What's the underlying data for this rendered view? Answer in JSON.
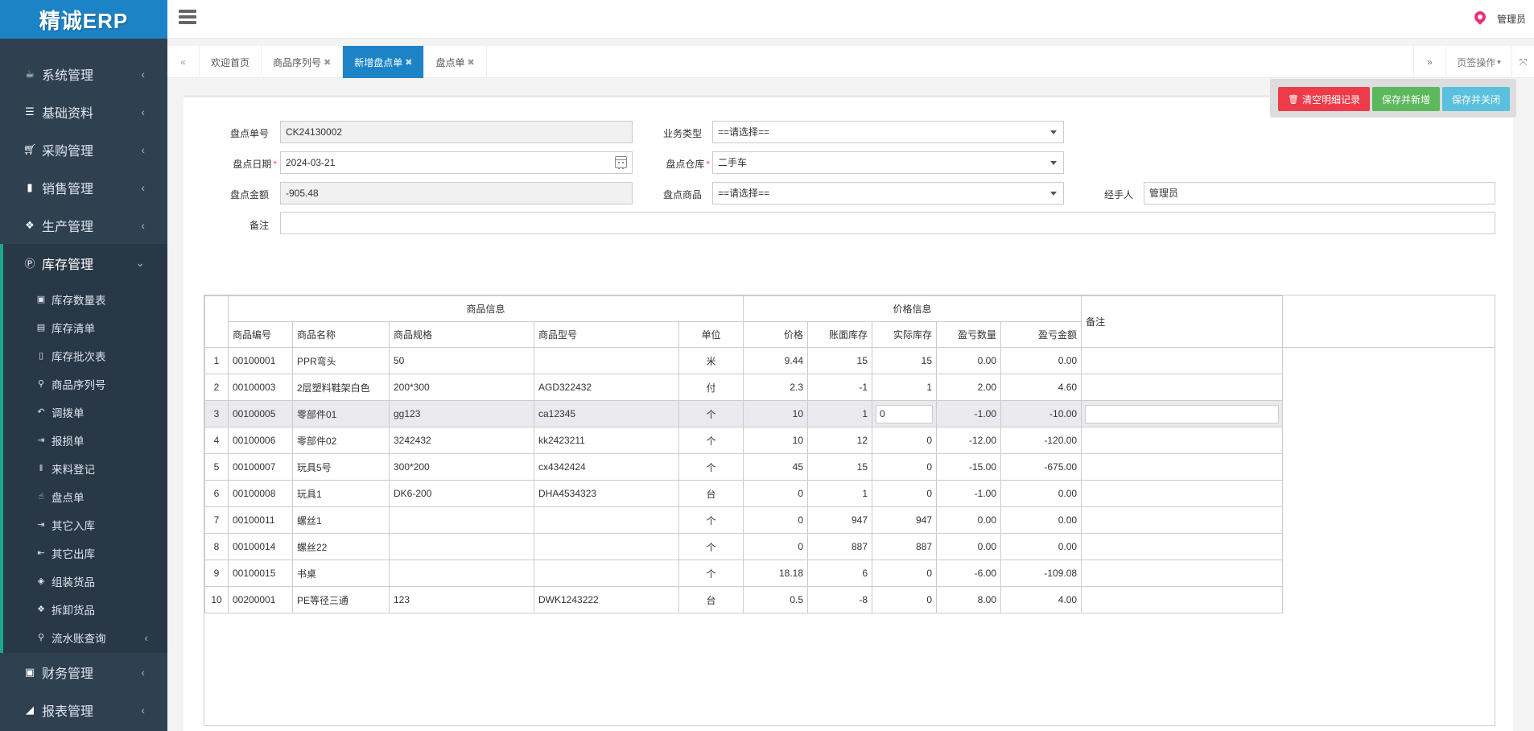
{
  "app": {
    "logo": "精诚ERP"
  },
  "header": {
    "user_name": "管理员"
  },
  "sidebar": {
    "items": [
      {
        "label": "系统管理",
        "icon": "coffee-icon"
      },
      {
        "label": "基础资料",
        "icon": "list-icon"
      },
      {
        "label": "采购管理",
        "icon": "cart-icon"
      },
      {
        "label": "销售管理",
        "icon": "book-icon"
      },
      {
        "label": "生产管理",
        "icon": "cubes-icon"
      },
      {
        "label": "库存管理",
        "icon": "product-hunt-icon"
      },
      {
        "label": "财务管理",
        "icon": "money-icon"
      },
      {
        "label": "报表管理",
        "icon": "chart-icon"
      }
    ],
    "sub_items": [
      {
        "label": "库存数量表",
        "icon": "money-icon"
      },
      {
        "label": "库存清单",
        "icon": "list-alt-icon"
      },
      {
        "label": "库存批次表",
        "icon": "file-icon"
      },
      {
        "label": "商品序列号",
        "icon": "search-icon"
      },
      {
        "label": "调拨单",
        "icon": "reply-icon"
      },
      {
        "label": "报损单",
        "icon": "sign-in-icon"
      },
      {
        "label": "来料登记",
        "icon": "barcode-icon"
      },
      {
        "label": "盘点单",
        "icon": "hand-icon"
      },
      {
        "label": "其它入库",
        "icon": "sign-in-icon"
      },
      {
        "label": "其它出库",
        "icon": "sign-out-icon"
      },
      {
        "label": "组装货品",
        "icon": "cube-icon"
      },
      {
        "label": "拆卸货品",
        "icon": "cubes-icon"
      },
      {
        "label": "流水账查询",
        "icon": "search-icon"
      }
    ]
  },
  "tabs": [
    {
      "label": "欢迎首页",
      "closable": false
    },
    {
      "label": "商品序列号",
      "closable": true
    },
    {
      "label": "新增盘点单",
      "closable": true,
      "active": true
    },
    {
      "label": "盘点单",
      "closable": true
    }
  ],
  "tab_actions": {
    "page_ops": "页签操作"
  },
  "toolbar": {
    "clear_label": "清空明细记录",
    "save_new_label": "保存并新增",
    "save_close_label": "保存并关闭"
  },
  "form": {
    "order_no_label": "盘点单号",
    "order_no": "CK24130002",
    "date_label": "盘点日期",
    "date": "2024-03-21",
    "amount_label": "盘点金额",
    "amount": "-905.48",
    "note_label": "备注",
    "note": "",
    "biz_type_label": "业务类型",
    "biz_type": "==请选择==",
    "warehouse_label": "盘点仓库",
    "warehouse": "二手车",
    "goods_label": "盘点商品",
    "goods": "==请选择==",
    "handler_label": "经手人",
    "handler": "管理员"
  },
  "grid": {
    "group_headers": {
      "goods_info": "商品信息",
      "price_info": "价格信息"
    },
    "columns": {
      "code": "商品编号",
      "name": "商品名称",
      "spec": "商品规格",
      "model": "商品型号",
      "unit": "单位",
      "price": "价格",
      "book_stock": "账面库存",
      "actual_stock": "实际库存",
      "diff_qty": "盈亏数量",
      "diff_amount": "盈亏金额",
      "note": "备注"
    },
    "rows": [
      {
        "idx": "1",
        "code": "00100001",
        "name": "PPR弯头",
        "spec": "50",
        "model": "",
        "unit": "米",
        "price": "9.44",
        "book": "15",
        "actual": "15",
        "qty": "0.00",
        "amt": "0.00",
        "note": ""
      },
      {
        "idx": "2",
        "code": "00100003",
        "name": "2层塑料鞋架白色",
        "spec": "200*300",
        "model": "AGD322432",
        "unit": "付",
        "price": "2.3",
        "book": "-1",
        "actual": "1",
        "qty": "2.00",
        "amt": "4.60",
        "note": ""
      },
      {
        "idx": "3",
        "code": "00100005",
        "name": "零部件01",
        "spec": "gg123",
        "model": "ca12345",
        "unit": "个",
        "price": "10",
        "book": "1",
        "actual": "0",
        "qty": "-1.00",
        "amt": "-10.00",
        "note": ""
      },
      {
        "idx": "4",
        "code": "00100006",
        "name": "零部件02",
        "spec": "3242432",
        "model": "kk2423211",
        "unit": "个",
        "price": "10",
        "book": "12",
        "actual": "0",
        "qty": "-12.00",
        "amt": "-120.00",
        "note": ""
      },
      {
        "idx": "5",
        "code": "00100007",
        "name": "玩具5号",
        "spec": "300*200",
        "model": "cx4342424",
        "unit": "个",
        "price": "45",
        "book": "15",
        "actual": "0",
        "qty": "-15.00",
        "amt": "-675.00",
        "note": ""
      },
      {
        "idx": "6",
        "code": "00100008",
        "name": "玩具1",
        "spec": "DK6-200",
        "model": "DHA4534323",
        "unit": "台",
        "price": "0",
        "book": "1",
        "actual": "0",
        "qty": "-1.00",
        "amt": "0.00",
        "note": ""
      },
      {
        "idx": "7",
        "code": "00100011",
        "name": "螺丝1",
        "spec": "",
        "model": "",
        "unit": "个",
        "price": "0",
        "book": "947",
        "actual": "947",
        "qty": "0.00",
        "amt": "0.00",
        "note": ""
      },
      {
        "idx": "8",
        "code": "00100014",
        "name": "螺丝22",
        "spec": "",
        "model": "",
        "unit": "个",
        "price": "0",
        "book": "887",
        "actual": "887",
        "qty": "0.00",
        "amt": "0.00",
        "note": ""
      },
      {
        "idx": "9",
        "code": "00100015",
        "name": "书桌",
        "spec": "",
        "model": "",
        "unit": "个",
        "price": "18.18",
        "book": "6",
        "actual": "0",
        "qty": "-6.00",
        "amt": "-109.08",
        "note": ""
      },
      {
        "idx": "10",
        "code": "00200001",
        "name": "PE等径三通",
        "spec": "123",
        "model": "DWK1243222",
        "unit": "台",
        "price": "0.5",
        "book": "-8",
        "actual": "0",
        "qty": "8.00",
        "amt": "4.00",
        "note": ""
      }
    ]
  }
}
